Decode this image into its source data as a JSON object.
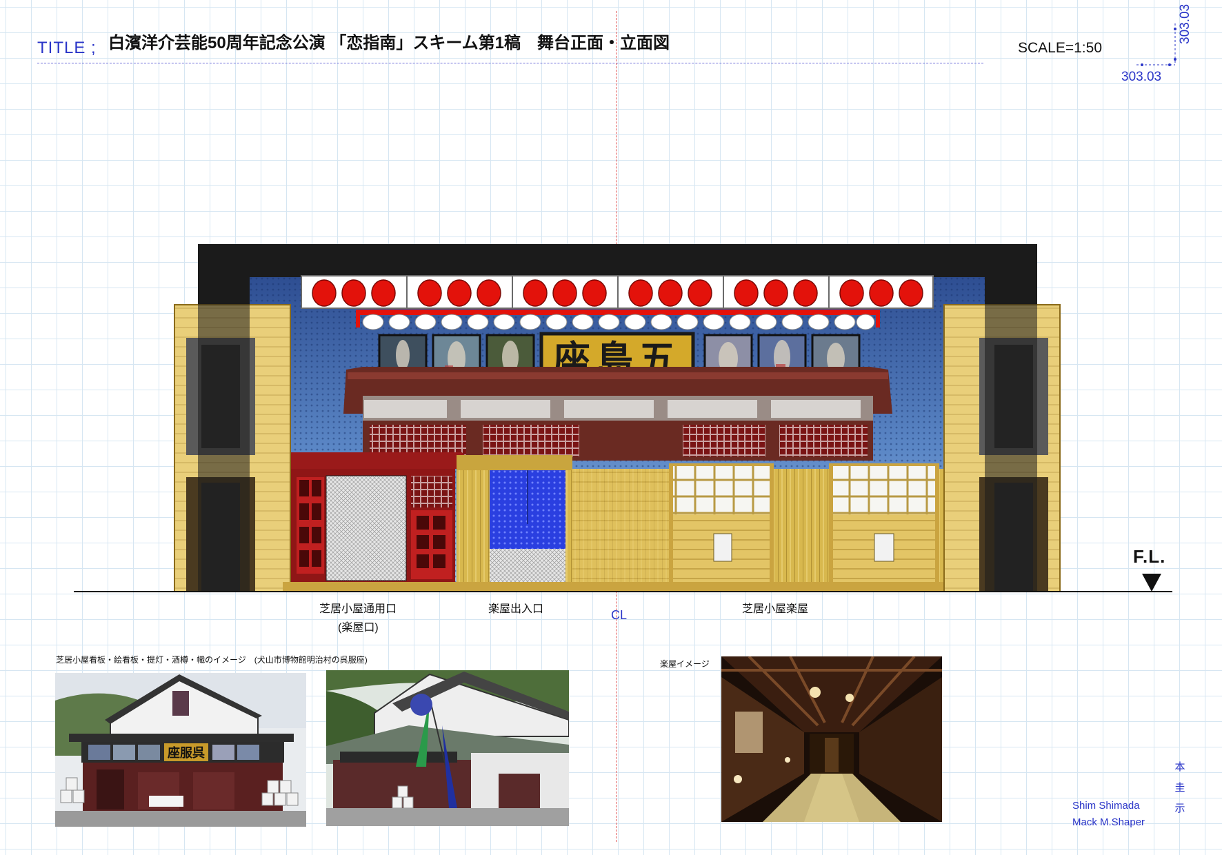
{
  "header": {
    "title_label": "TITLE ;",
    "title": "白濱洋介芸能50周年記念公演 「恋指南」スキーム第1稿　舞台正面・立面図",
    "scale": "SCALE=1:50",
    "dim_horizontal": "303.03",
    "dim_vertical": "303.03"
  },
  "drawing": {
    "sign_text": "座島五",
    "floor_label": "F.L.",
    "centerline_mark": "CL",
    "labels": {
      "entrance": "芝居小屋通用口",
      "entrance_sub": "(楽屋口)",
      "green_room_door": "楽屋出入口",
      "green_room": "芝居小屋楽屋"
    },
    "colors": {
      "frame": "#1a1a1a",
      "backdrop": "#2d4f8f",
      "lantern_red": "#e3120b",
      "wood_gold": "#d9b84a",
      "lattice_red": "#b01b1b",
      "noren_blue": "#2a3fe0",
      "sign_gold": "#d4a92a"
    }
  },
  "photos": {
    "caption_left": "芝居小屋看板・絵看板・提灯・酒樽・幟のイメージ　(犬山市博物館明治村の呉服座)",
    "caption_right": "楽屋イメージ",
    "photo1_sign": "座服呉"
  },
  "signature": {
    "name1": "Shim Shimada",
    "name2": "Mack M.Shaper",
    "seal": [
      "本",
      "圭",
      "示"
    ]
  }
}
